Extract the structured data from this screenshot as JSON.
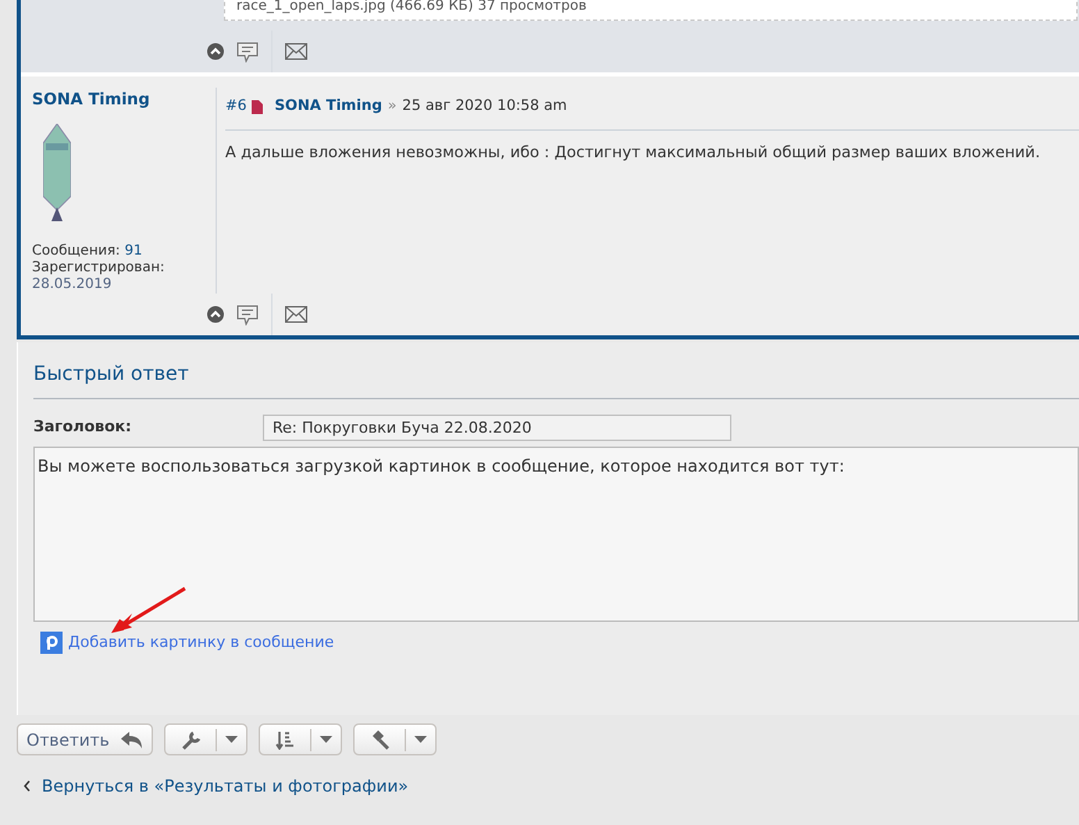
{
  "previous_post": {
    "attachment": "race_1_open_laps.jpg (466.69 КБ) 37 просмотров"
  },
  "post": {
    "author": "SONA Timing",
    "posts_label": "Сообщения:",
    "posts_count": "91",
    "registered_label": "Зарегистрирован:",
    "registered_date": "28.05.2019",
    "number": "#6",
    "header_author": "SONA Timing",
    "separator": "»",
    "date": "25 авг 2020 10:58 am",
    "body": "А дальше вложения невозможны, ибо : Достигнут максимальный общий размер ваших вложений."
  },
  "quick_reply": {
    "title": "Быстрый ответ",
    "subject_label": "Заголовок:",
    "subject_value": "Re: Покруговки Буча 22.08.2020",
    "message": "Вы можете воспользоваться загрузкой картинок в сообщение, которое находится вот тут:",
    "upload_link": "Добавить картинку в сообщение"
  },
  "toolbar": {
    "reply_button": "Ответить",
    "dropdowns": [
      {
        "kind": "wrench"
      },
      {
        "kind": "sort"
      },
      {
        "kind": "hammer"
      }
    ]
  },
  "back_link": "Вернуться в «Результаты и фотографии»"
}
